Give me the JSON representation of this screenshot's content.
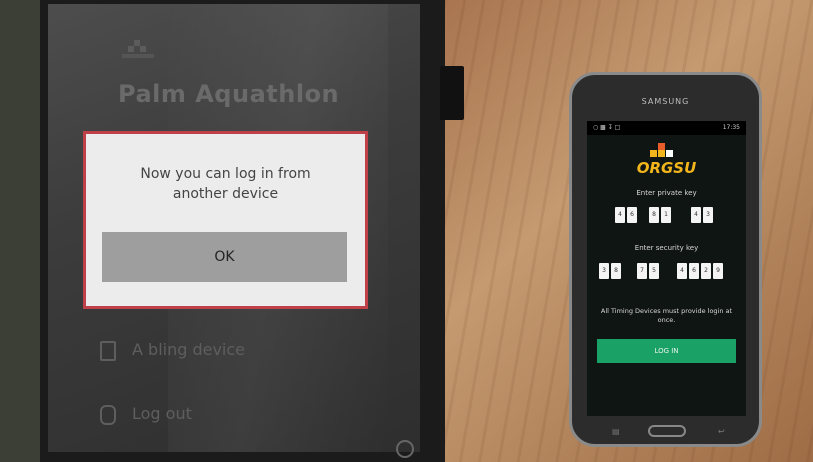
{
  "tablet": {
    "app_title": "Palm Aquathlon",
    "dialog": {
      "message_line1": "Now you can log in from",
      "message_line2": "another device",
      "ok_label": "OK"
    },
    "menu": [
      {
        "label": "A   bling device",
        "icon": "phone-icon"
      },
      {
        "label": "Log out",
        "icon": "logout-icon"
      }
    ],
    "dialog_border_color": "#c0404a"
  },
  "phone": {
    "brand": "SAMSUNG",
    "status_time": "17:35",
    "logo_text": "ORGSU",
    "private_key_label": "Enter private key",
    "private_key": [
      "4",
      "6",
      "8",
      "1",
      "4",
      "3"
    ],
    "security_key_label": "Enter security key",
    "security_key": [
      "3",
      "8",
      "7",
      "5",
      "4",
      "6",
      "2",
      "9"
    ],
    "warning": "All Timing Devices must provide login at once.",
    "login_label": "LOG IN",
    "accent_color": "#1aa166",
    "logo_color": "#f3b51c"
  }
}
